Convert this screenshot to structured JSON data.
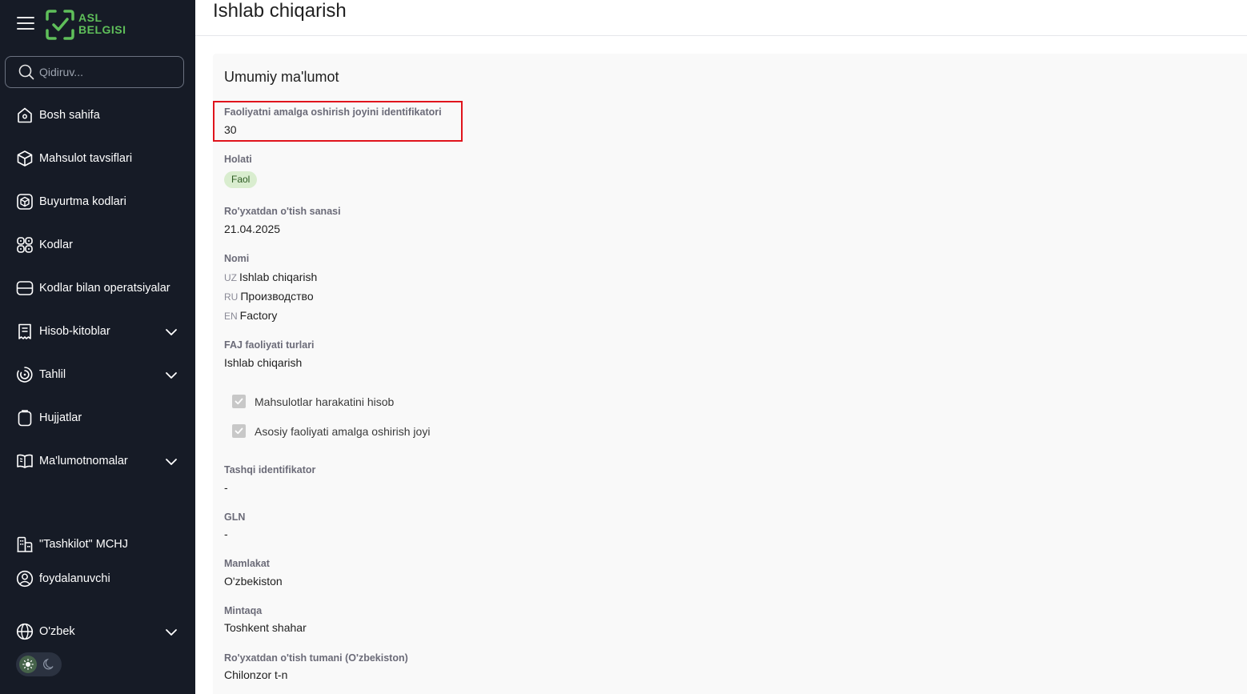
{
  "sidebar": {
    "logo_line1": "ASL",
    "logo_line2": "BELGISI",
    "search_placeholder": "Qidiruv...",
    "items": [
      {
        "label": "Bosh sahifa",
        "icon": "home-icon"
      },
      {
        "label": "Mahsulot tavsiflari",
        "icon": "cube-icon"
      },
      {
        "label": "Buyurtma kodlari",
        "icon": "box-icon"
      },
      {
        "label": "Kodlar",
        "icon": "codes-grid-icon"
      },
      {
        "label": "Kodlar bilan operatsiyalar",
        "icon": "server-icon"
      },
      {
        "label": "Hisob-kitoblar",
        "icon": "receipt-icon"
      },
      {
        "label": "Tahlil",
        "icon": "analytics-icon"
      },
      {
        "label": "Hujjatlar",
        "icon": "clipboard-icon"
      },
      {
        "label": "Ma'lumotnomalar",
        "icon": "book-icon"
      }
    ],
    "organization": "\"Tashkilot\" MCHJ",
    "user": "foydalanuvchi",
    "language": "O'zbek"
  },
  "header": {
    "title": "Ishlab chiqarish"
  },
  "card": {
    "title": "Umumiy ma'lumot",
    "fields": {
      "place_id": {
        "label": "Faoliyatni amalga oshirish joyini identifikatori",
        "value": "30"
      },
      "status": {
        "label": "Holati",
        "value": "Faol"
      },
      "reg_date": {
        "label": "Ro'yxatdan o'tish sanasi",
        "value": "21.04.2025"
      },
      "name": {
        "label": "Nomi",
        "uz_code": "UZ",
        "uz": "Ishlab chiqarish",
        "ru_code": "RU",
        "ru": "Производство",
        "en_code": "EN",
        "en": "Factory"
      },
      "faj_types": {
        "label": "FAJ faoliyati turlari",
        "value": "Ishlab chiqarish"
      },
      "checkbox1": "Mahsulotlar harakatini hisob",
      "checkbox2": "Asosiy faoliyati amalga oshirish joyi",
      "external_id": {
        "label": "Tashqi identifikator",
        "value": "-"
      },
      "gln": {
        "label": "GLN",
        "value": "-"
      },
      "country": {
        "label": "Mamlakat",
        "value": "O'zbekiston"
      },
      "region": {
        "label": "Mintaqa",
        "value": "Toshkent shahar"
      },
      "district": {
        "label": "Ro'yxatdan o'tish tumani (O'zbekiston)",
        "value": "Chilonzor t-n"
      }
    }
  },
  "colors": {
    "sidebar_bg": "#161b26",
    "accent_green": "#5fbf5a",
    "highlight_red": "#e0141c",
    "badge_bg": "#d9edcf"
  }
}
